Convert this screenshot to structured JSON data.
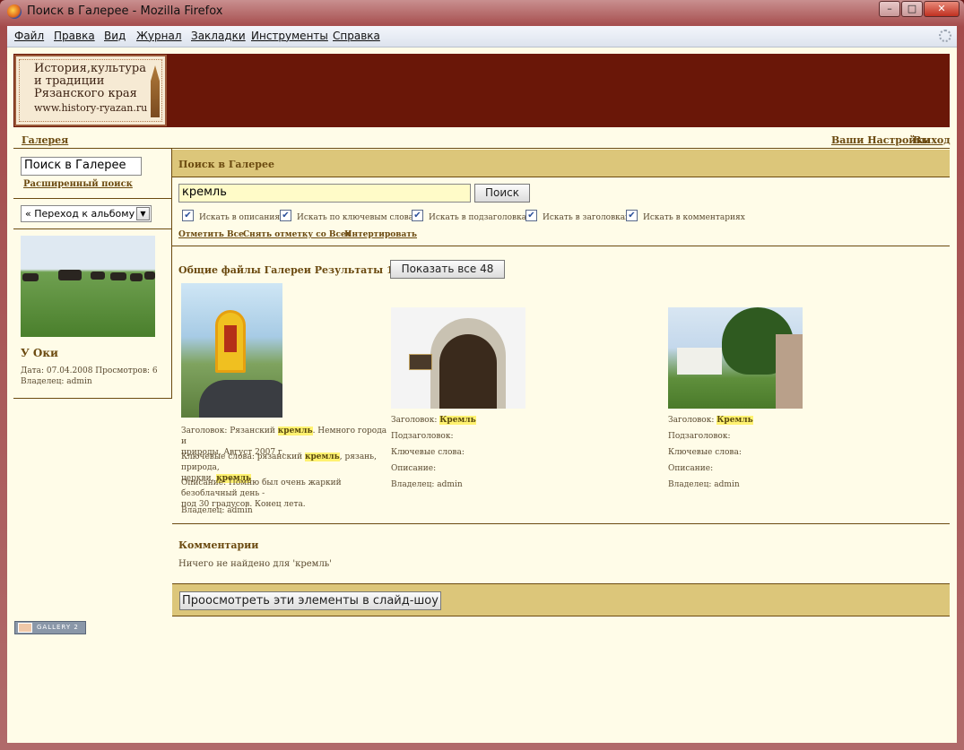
{
  "window": {
    "title": "Поиск в Галерее - Mozilla Firefox",
    "minimize": "–",
    "maximize": "□",
    "close": "✕"
  },
  "menu": [
    "Файл",
    "Правка",
    "Вид",
    "Журнал",
    "Закладки",
    "Инструменты",
    "Справка"
  ],
  "logo": {
    "text": "История,культура\nи традиции\nРязанского края",
    "url": "www.history-ryazan.ru"
  },
  "nav": {
    "gallery": "Галерея",
    "settings": "Ваши Настройки",
    "logout": "Выход"
  },
  "sidebar": {
    "search_value": "Поиск в Галерее",
    "advanced": "Расширенный поиск",
    "jump": "« Переход к альбому »",
    "photo_title": "У Оки",
    "meta_date": "Дата: 07.04.2008 Просмотров: 6",
    "meta_owner": "Владелец: admin"
  },
  "main": {
    "title": "Поиск в Галерее",
    "query": "кремль",
    "search_button": "Поиск",
    "options": [
      {
        "label": "Искать в описаниях",
        "checked": true
      },
      {
        "label": "Искать по ключевым словам",
        "checked": true
      },
      {
        "label": "Искать в подзаголовках",
        "checked": true
      },
      {
        "label": "Искать в заголовках",
        "checked": true
      },
      {
        "label": "Искать в комментариях",
        "checked": true
      }
    ],
    "actions": [
      "Отметить Все",
      "Снять отметку со Всех",
      "Интертировать"
    ],
    "results_title": "Общие файлы Галереи Результаты 1 - 3",
    "show_all": "Показать все 48",
    "results": [
      {
        "title_pre": "Заголовок: Рязанский ",
        "title_hl": "кремль",
        "title_post": ". Немного города и",
        "title_line2": "природы. Август 2007 г.",
        "kw_pre": "Ключевые слова: рязанский ",
        "kw_hl": "кремль",
        "kw_post": ", рязань, природа,",
        "kw_line2": "церкви, ",
        "kw_hl2": "кремль",
        "desc_line1": "Описание: Помню был очень жаркий безоблачный день -",
        "desc_line2": "под 30 градусов. Конец лета.",
        "owner": "Владелец: admin"
      },
      {
        "title_pre": "Заголовок: ",
        "title_hl": "Кремль",
        "subtitle": "Подзаголовок:",
        "keywords": "Ключевые слова:",
        "desc": "Описание:",
        "owner": "Владелец: admin"
      },
      {
        "title_pre": "Заголовок: ",
        "title_hl": "Кремль",
        "subtitle": "Подзаголовок:",
        "keywords": "Ключевые слова:",
        "desc": "Описание:",
        "owner": "Владелец: admin"
      }
    ],
    "comments_title": "Комментарии",
    "comments_none": "Ничего не найдено для 'кремль'",
    "slideshow": "Проосмотреть эти элементы в слайд-шоу"
  },
  "badge": "GALLERY 2",
  "colors": {
    "banner": "#6a1708",
    "header_bar": "#dcc67a",
    "page_bg": "#fffce8",
    "link": "#6b4a10",
    "highlight": "#fff270"
  }
}
